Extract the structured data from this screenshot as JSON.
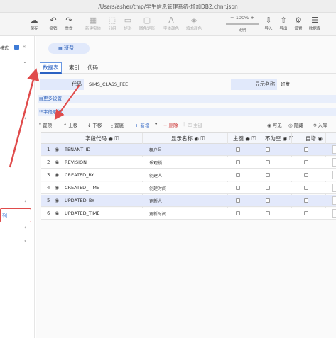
{
  "window": {
    "title": "/Users/asher/tmp/学生信息管理系统-增加DB2.chnr.json"
  },
  "toolbar": {
    "save": "保存",
    "undo": "撤销",
    "redo": "重做",
    "new_entity": "新建实体",
    "group": "分组",
    "rect": "矩形",
    "rounded_rect": "圆角矩形",
    "font_color": "字体颜色",
    "fill_color": "填充颜色",
    "zoom_value": "100%",
    "zoom_label": "比例",
    "import": "导入",
    "export": "导出",
    "settings": "设置",
    "database": "数据库"
  },
  "left_panel": {
    "mode_label": "模式",
    "selected_item": "列"
  },
  "entity": {
    "button_label": "班费"
  },
  "tabs": [
    {
      "label": "数据表"
    },
    {
      "label": "索引"
    },
    {
      "label": "代码"
    }
  ],
  "form": {
    "code_label": "代码",
    "code_value": "SIMS_CLASS_FEE",
    "display_label": "显示名称",
    "display_value": "班费"
  },
  "sections": {
    "more_settings": "更多设置",
    "field_details": "字段明细"
  },
  "field_toolbar": {
    "top": "置顶",
    "up": "上移",
    "down": "下移",
    "bottom": "置底",
    "add": "+ 新增",
    "delete": "删除",
    "pk": "主键",
    "visible": "可见",
    "hidden": "隐藏",
    "import": "入库"
  },
  "grid": {
    "columns": {
      "code": "字段代码",
      "display": "显示名称",
      "pk": "主键",
      "not_null": "不为空",
      "auto_inc": "自增"
    },
    "rows": [
      {
        "num": "1",
        "code": "TENANT_ID",
        "name": "租户号",
        "pk": false,
        "not_null": false,
        "auto_inc": false,
        "selected": true
      },
      {
        "num": "2",
        "code": "REVISION",
        "name": "乐观锁",
        "pk": false,
        "not_null": false,
        "auto_inc": false,
        "selected": false
      },
      {
        "num": "3",
        "code": "CREATED_BY",
        "name": "创建人",
        "pk": false,
        "not_null": false,
        "auto_inc": false,
        "selected": false
      },
      {
        "num": "4",
        "code": "CREATED_TIME",
        "name": "创建时间",
        "pk": false,
        "not_null": false,
        "auto_inc": false,
        "selected": false
      },
      {
        "num": "5",
        "code": "UPDATED_BY",
        "name": "更新人",
        "pk": false,
        "not_null": false,
        "auto_inc": false,
        "selected": true
      },
      {
        "num": "6",
        "code": "UPDATED_TIME",
        "name": "更新时间",
        "pk": false,
        "not_null": false,
        "auto_inc": false,
        "selected": false
      }
    ]
  },
  "colors": {
    "accent": "#2b62c3",
    "highlight": "#e04b4b",
    "label_bg": "#e1e9fb"
  }
}
